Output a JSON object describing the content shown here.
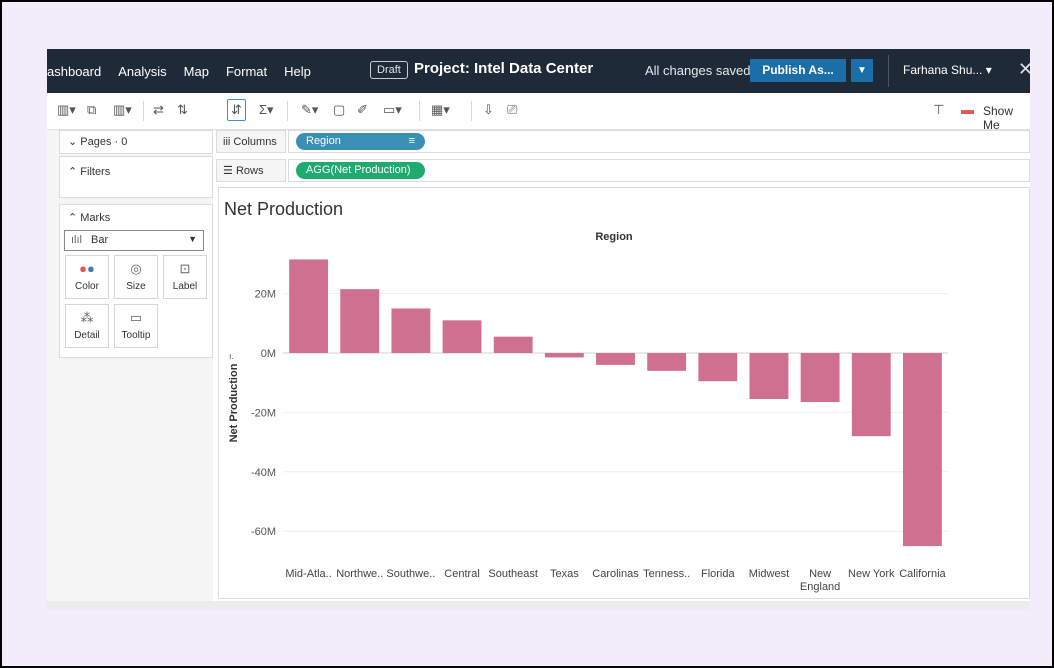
{
  "menu": [
    "ashboard",
    "Analysis",
    "Map",
    "Format",
    "Help"
  ],
  "header": {
    "draft_badge": "Draft",
    "project_title": "Project: Intel Data Center",
    "save_status": "All changes saved",
    "publish_label": "Publish As...",
    "user_name": "Farhana Shu...",
    "close_symbol": "✕"
  },
  "toolbar": {
    "show_me_label": "Show Me"
  },
  "panels": {
    "pages_label": "Pages · 0",
    "filters_label": "Filters",
    "marks_label": "Marks",
    "mark_type": "Bar",
    "mark_buttons": [
      {
        "label": "Color",
        "icon": "color-icon"
      },
      {
        "label": "Size",
        "icon": "size-icon"
      },
      {
        "label": "Label",
        "icon": "label-icon"
      },
      {
        "label": "Detail",
        "icon": "detail-icon"
      },
      {
        "label": "Tooltip",
        "icon": "tooltip-icon"
      }
    ]
  },
  "shelves": {
    "columns_label": "Columns",
    "columns_pill": "Region",
    "rows_label": "Rows",
    "rows_pill": "AGG(Net Production)"
  },
  "colors": {
    "topbar": "#1f2a38",
    "publish": "#1b6ea7",
    "columns_pill": "#3a8fb4",
    "rows_pill": "#1fab6f",
    "bar": "#d07090"
  },
  "chart_data": {
    "type": "bar",
    "title": "Net Production",
    "xlabel": "Region",
    "ylabel": "Net Production",
    "categories": [
      "Mid-Atla..",
      "Northwe..",
      "Southwe..",
      "Central",
      "Southeast",
      "Texas",
      "Carolinas",
      "Tenness..",
      "Florida",
      "Midwest",
      "New England",
      "New York",
      "California"
    ],
    "values": [
      31.5,
      21.5,
      15,
      11,
      5.5,
      -1.5,
      -4,
      -6,
      -9.5,
      -15.5,
      -16.5,
      -28,
      -65
    ],
    "unit": "M",
    "yticks": [
      20,
      0,
      -20,
      -40,
      -60
    ],
    "ytick_labels": [
      "20M",
      "0M",
      "-20M",
      "-40M",
      "-60M"
    ],
    "ylim": [
      -68,
      33
    ],
    "grid": true
  }
}
